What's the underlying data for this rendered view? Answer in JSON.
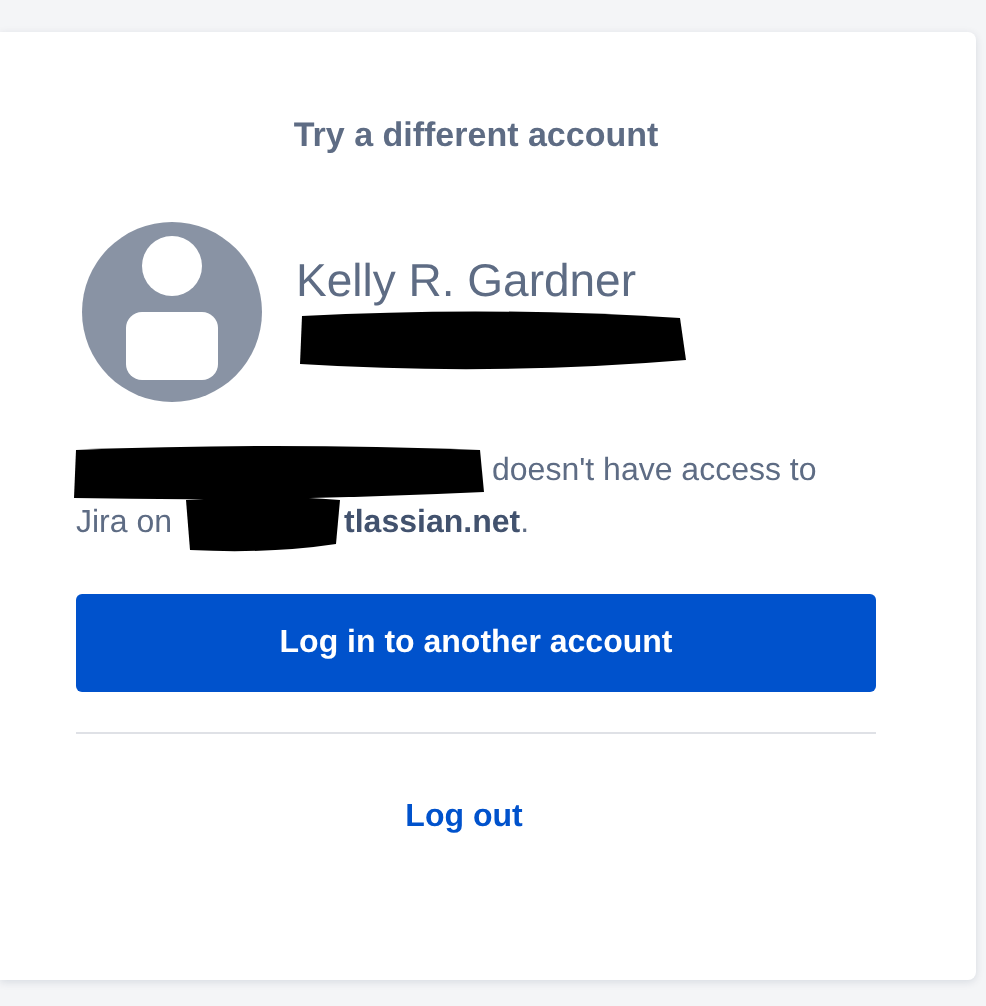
{
  "heading": "Try a different account",
  "account": {
    "name": "Kelly R. Gardner"
  },
  "message": [
    "doesn't have access to",
    "Jira on",
    "**tlassian.net**."
  ],
  "primary_button": "Log in to another account",
  "logout_link": "Log out"
}
